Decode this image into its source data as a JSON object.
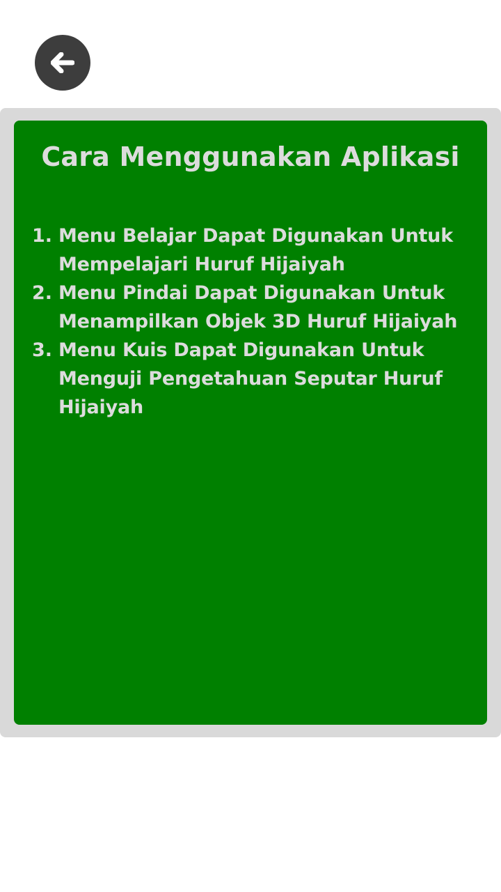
{
  "header": {
    "back_icon": "arrow-left-icon"
  },
  "panel": {
    "title": "Cara Menggunakan Aplikasi",
    "instructions": [
      {
        "number": "1.",
        "text": "Menu Belajar Dapat Digunakan Untuk Mempelajari Huruf Hijaiyah"
      },
      {
        "number": "2.",
        "text": "Menu Pindai Dapat Digunakan Untuk Menampilkan Objek 3D Huruf Hijaiyah"
      },
      {
        "number": "3.",
        "text": "Menu Kuis Dapat Digunakan Untuk Menguji Pengetahuan Seputar Huruf Hijaiyah"
      }
    ]
  },
  "colors": {
    "panel_background": "#008000",
    "panel_frame": "#d9d9d9",
    "back_button": "#3d3d3d",
    "text": "#dcdcdc"
  }
}
